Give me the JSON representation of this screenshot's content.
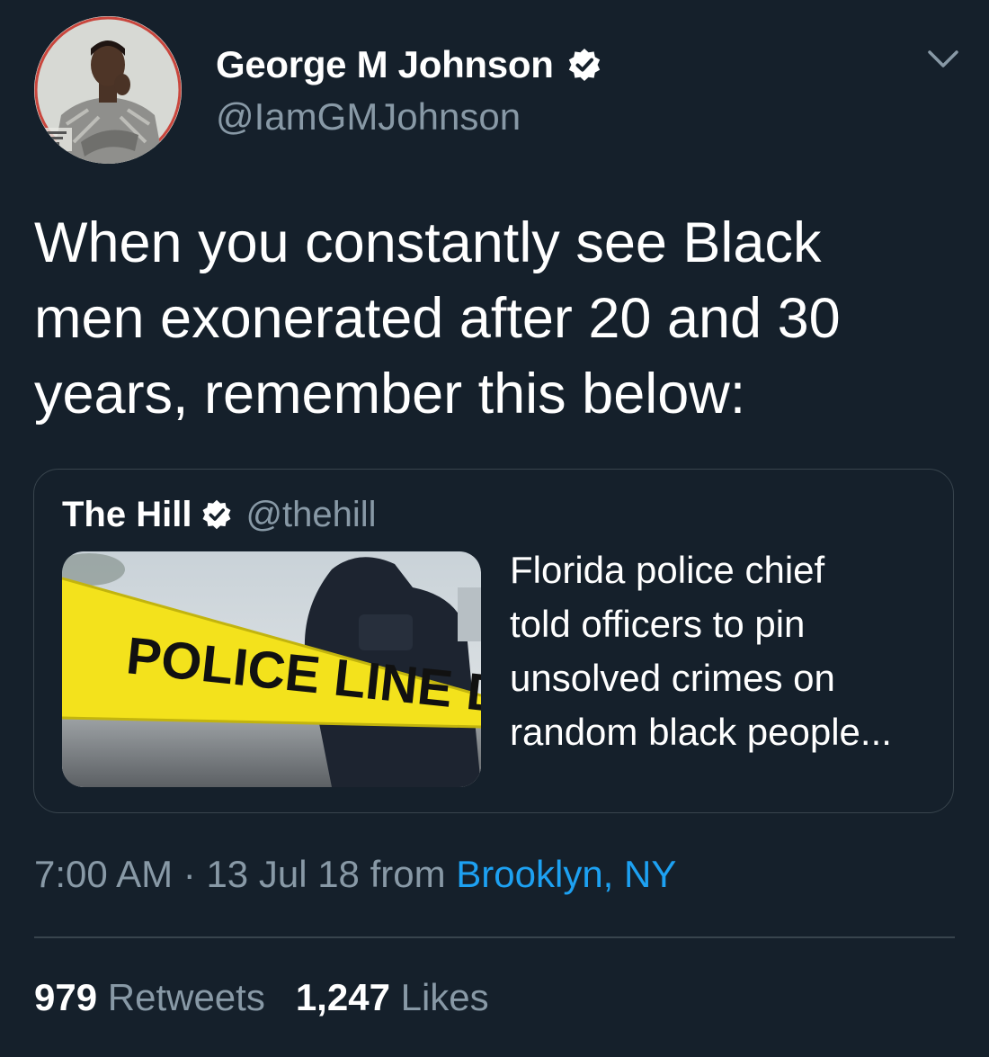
{
  "tweet": {
    "author": {
      "display_name": "George M Johnson",
      "handle": "@IamGMJohnson",
      "verified": true,
      "avatar_icon": "profile-photo"
    },
    "text_lines": [
      "When you constantly see Black",
      "men exonerated after 20 and 30",
      "years, remember this below:"
    ],
    "quoted": {
      "display_name": "The Hill",
      "handle": "@thehill",
      "verified": true,
      "image_text": "POLICE LINE DO NOT CROSS",
      "headline_lines": [
        "Florida police chief",
        "told officers to pin",
        "unsolved crimes on",
        "random black people..."
      ]
    },
    "meta": {
      "time": "7:00 AM",
      "separator": "·",
      "date": "13 Jul 18",
      "from_label": "from",
      "location": "Brooklyn, NY"
    },
    "stats": {
      "retweets_count": "979",
      "retweets_label": "Retweets",
      "likes_count": "1,247",
      "likes_label": "Likes"
    }
  },
  "colors": {
    "background": "#15202b",
    "text_primary": "#ffffff",
    "text_secondary": "#8899a6",
    "link": "#1da1f2",
    "border": "#38444d",
    "tape_yellow": "#f3e21c"
  },
  "icons": {
    "verified": "verified-badge-icon",
    "menu": "chevron-down-icon"
  }
}
